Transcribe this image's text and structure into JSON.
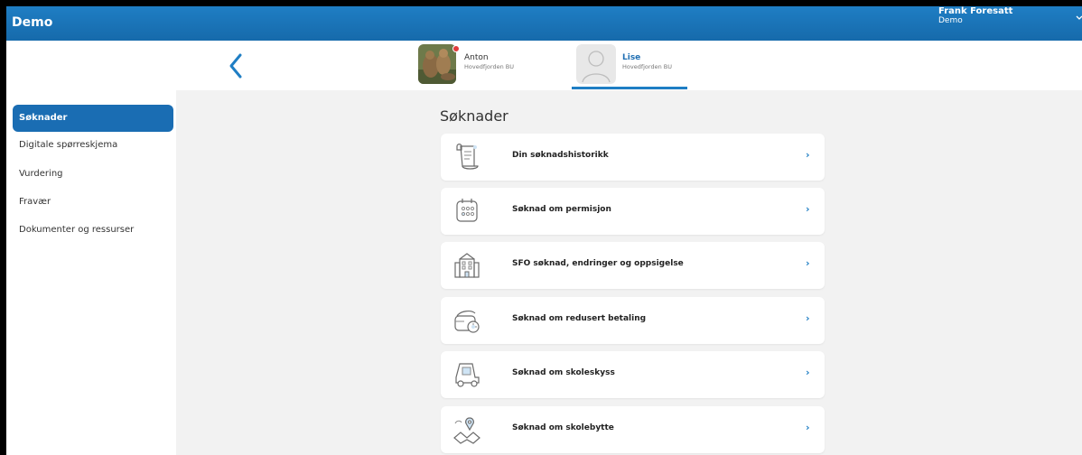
{
  "header": {
    "app_title": "Demo",
    "user_name": "Frank Foresatt",
    "user_org": "Demo",
    "accent_color": "#1f7ec4"
  },
  "children": [
    {
      "name": "Anton",
      "school": "Hovedfjorden BU",
      "selected": false,
      "has_notification": true
    },
    {
      "name": "Lise",
      "school": "Hovedfjorden BU",
      "selected": true,
      "has_notification": false
    }
  ],
  "sidebar": {
    "items": [
      {
        "label": "Søknader",
        "active": true
      },
      {
        "label": "Digitale spørreskjema",
        "active": false
      },
      {
        "label": "Vurdering",
        "active": false
      },
      {
        "label": "Fravær",
        "active": false
      },
      {
        "label": "Dokumenter og ressurser",
        "active": false
      }
    ]
  },
  "main": {
    "title": "Søknader",
    "cards": [
      {
        "label": "Din søknadshistorikk",
        "icon": "scroll-icon"
      },
      {
        "label": "Søknad om permisjon",
        "icon": "calendar-icon"
      },
      {
        "label": "SFO søknad, endringer og oppsigelse",
        "icon": "school-building-icon"
      },
      {
        "label": "Søknad om redusert betaling",
        "icon": "wallet-icon"
      },
      {
        "label": "Søknad om skoleskyss",
        "icon": "bus-icon"
      },
      {
        "label": "Søknad om skolebytte",
        "icon": "map-pin-icon"
      }
    ]
  }
}
